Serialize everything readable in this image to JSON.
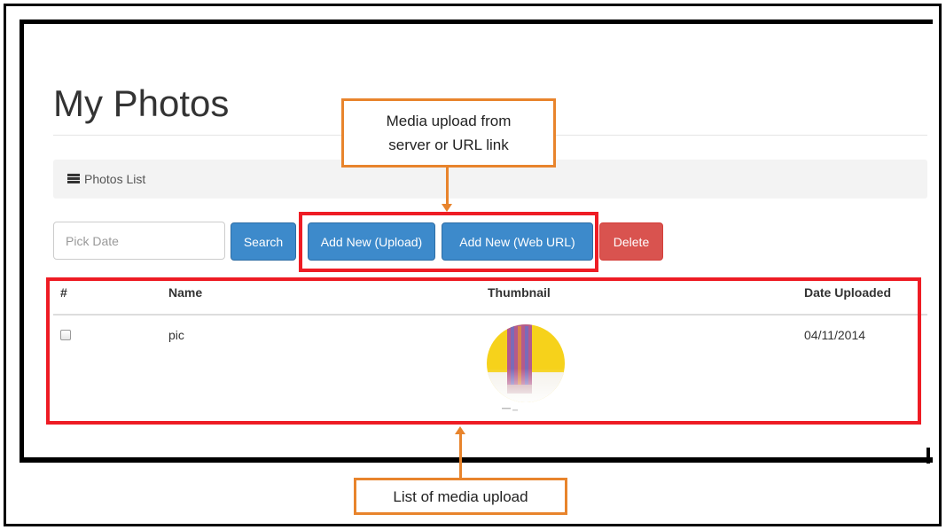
{
  "page": {
    "title": "My Photos"
  },
  "breadcrumb": {
    "icon": "list-icon",
    "label": "Photos List"
  },
  "toolbar": {
    "date_placeholder": "Pick Date",
    "search_label": "Search",
    "add_upload_label": "Add New (Upload)",
    "add_weburl_label": "Add New (Web URL)",
    "delete_label": "Delete"
  },
  "table": {
    "headers": [
      "#",
      "Name",
      "Thumbnail",
      "Date Uploaded"
    ],
    "rows": [
      {
        "name": "pic",
        "date": "04/11/2014",
        "checked": false
      }
    ]
  },
  "annotations": {
    "top_callout_line1": "Media upload from",
    "top_callout_line2": "server or URL link",
    "bottom_callout": "List of media upload"
  },
  "colors": {
    "primary": "#3d8acb",
    "danger": "#d9534f",
    "highlight_box": "#ee1c24",
    "callout": "#e8842c"
  }
}
